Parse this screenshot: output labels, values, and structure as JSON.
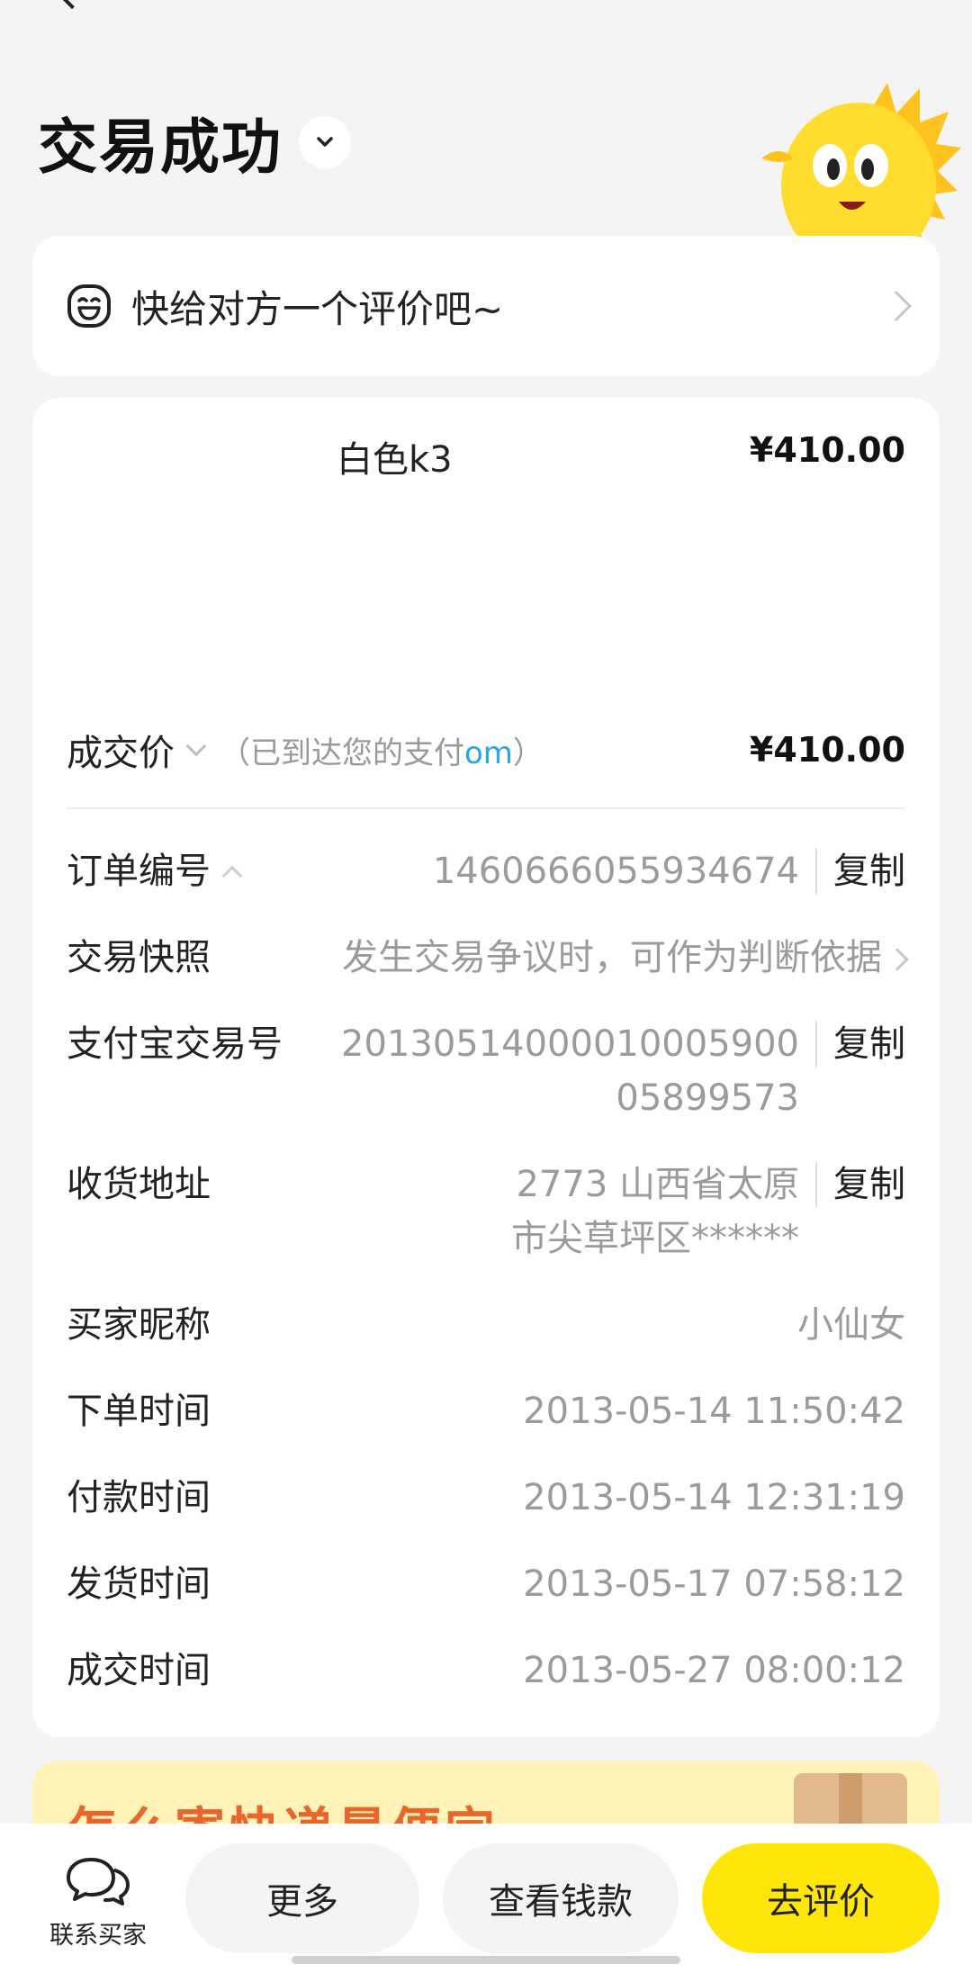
{
  "header": {
    "title": "交易成功"
  },
  "review_prompt": {
    "text": "快给对方一个评价吧~"
  },
  "product": {
    "title": "白色k3",
    "price": "¥410.00"
  },
  "deal": {
    "label": "成交价",
    "note_prefix": "（已到达您的支付",
    "note_link": "om",
    "note_suffix": "）",
    "price": "¥410.00"
  },
  "details": {
    "order_no": {
      "label": "订单编号",
      "value": "1460666055934674",
      "action": "复制"
    },
    "snapshot": {
      "label": "交易快照",
      "value": "发生交易争议时，可作为判断依据"
    },
    "alipay_no": {
      "label": "支付宝交易号",
      "value": "2013051400001000590005899573",
      "action": "复制"
    },
    "address": {
      "label": "收货地址",
      "value": "2773 山西省太原市尖草坪区******",
      "action": "复制"
    },
    "buyer": {
      "label": "买家昵称",
      "value": "小仙女"
    },
    "order_time": {
      "label": "下单时间",
      "value": "2013-05-14 11:50:42"
    },
    "pay_time": {
      "label": "付款时间",
      "value": "2013-05-14 12:31:19"
    },
    "ship_time": {
      "label": "发货时间",
      "value": "2013-05-17 07:58:12"
    },
    "deal_time": {
      "label": "成交时间",
      "value": "2013-05-27 08:00:12"
    }
  },
  "promo": {
    "text": "怎么寄快递最便宜"
  },
  "bottom": {
    "contact": "联系买家",
    "more": "更多",
    "view_money": "查看钱款",
    "review": "去评价"
  },
  "colors": {
    "accent": "#ffe60a",
    "link": "#28a7e0",
    "promo": "#e8662b"
  }
}
